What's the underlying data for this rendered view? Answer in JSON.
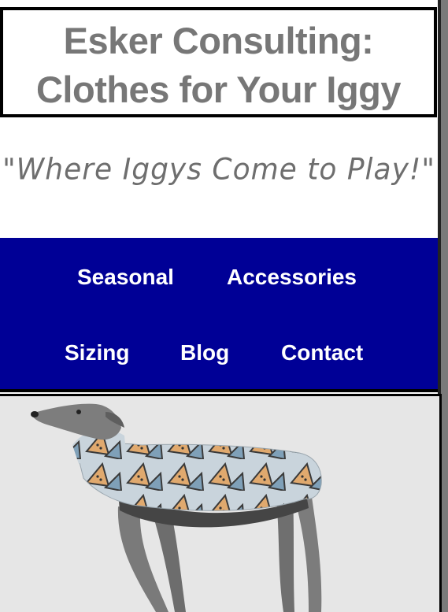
{
  "header": {
    "title_line1": "Esker Consulting:",
    "title_line2": "Clothes for Your Iggy"
  },
  "tagline": "\"Where Iggys Come to Play!\"",
  "nav": {
    "items": [
      {
        "label": "Seasonal"
      },
      {
        "label": "Accessories"
      },
      {
        "label": "Sizing"
      },
      {
        "label": "Blog"
      },
      {
        "label": "Contact"
      }
    ]
  },
  "hero": {
    "image": "italian-greyhound-wearing-patterned-sweater"
  },
  "colors": {
    "nav_bg": "#000096",
    "title_text": "#777777",
    "tagline_text": "#6e6e6e"
  }
}
